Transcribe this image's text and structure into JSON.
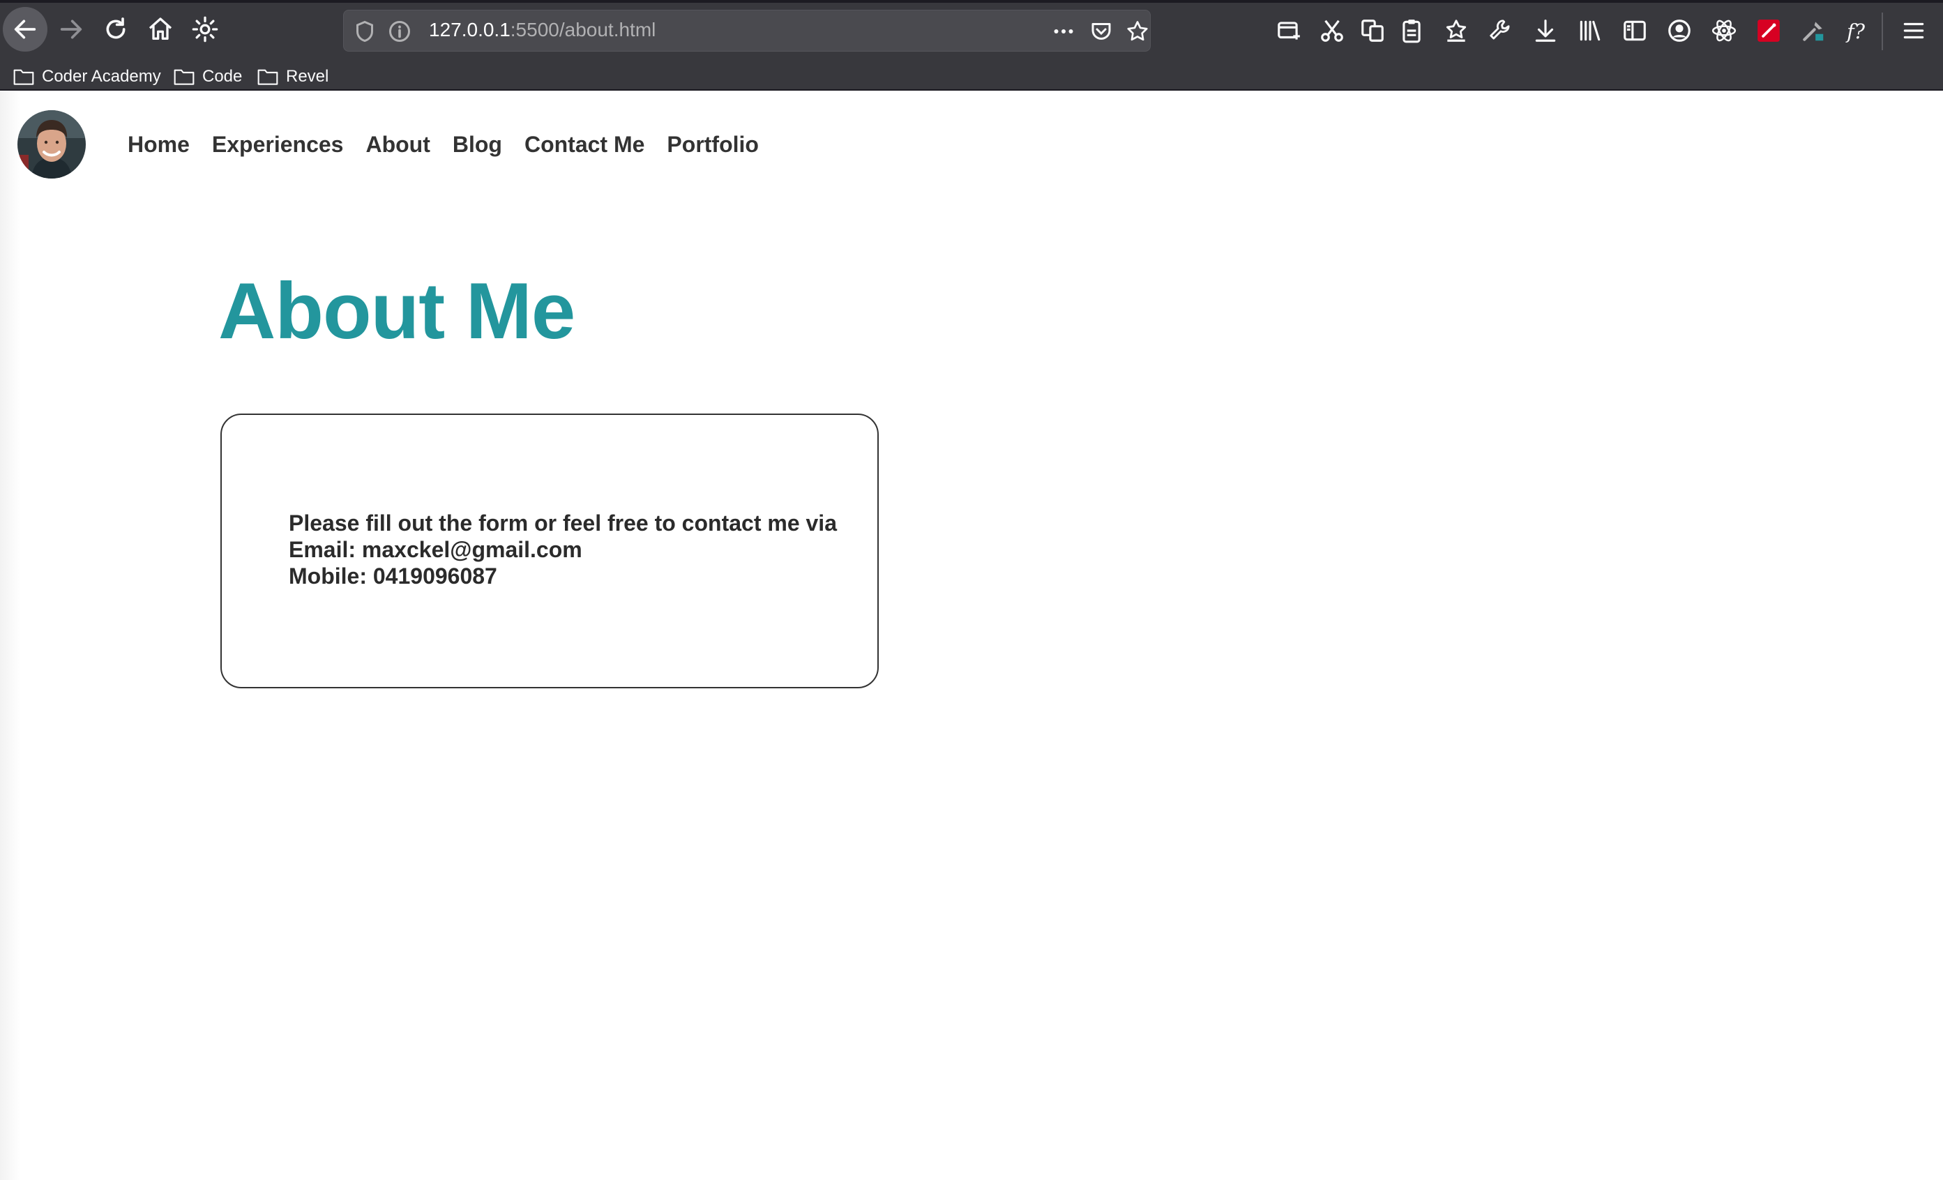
{
  "browser": {
    "url_host": "127.0.0.1",
    "url_path": ":5500/about.html",
    "toolbar_icons": [
      "back-arrow-icon",
      "forward-arrow-icon",
      "reload-icon",
      "home-icon",
      "settings-gear-icon",
      "page-actions-icon",
      "pocket-icon",
      "bookmark-star-icon",
      "screenshot-icon",
      "cut-icon",
      "copy-icon",
      "clipboard-icon",
      "reading-list-icon",
      "wrench-icon",
      "download-icon",
      "library-icon",
      "sidebar-icon",
      "account-icon",
      "react-devtools-icon",
      "extension-red-icon",
      "color-picker-icon",
      "font-finder-icon",
      "hamburger-menu-icon"
    ]
  },
  "bookmarks": [
    {
      "label": "Coder Academy"
    },
    {
      "label": "Code"
    },
    {
      "label": "Revel"
    }
  ],
  "nav": {
    "items": [
      {
        "label": "Home"
      },
      {
        "label": "Experiences"
      },
      {
        "label": "About"
      },
      {
        "label": "Blog"
      },
      {
        "label": "Contact Me"
      },
      {
        "label": "Portfolio"
      }
    ]
  },
  "main": {
    "title": "About Me",
    "contact_intro": "Please fill out the form or feel free to contact me via",
    "contact_email": "Email: maxckel@gmail.com",
    "contact_mobile": "Mobile: 0419096087"
  },
  "colors": {
    "accent": "#23969d",
    "text": "#333333",
    "chrome": "#38383d"
  }
}
